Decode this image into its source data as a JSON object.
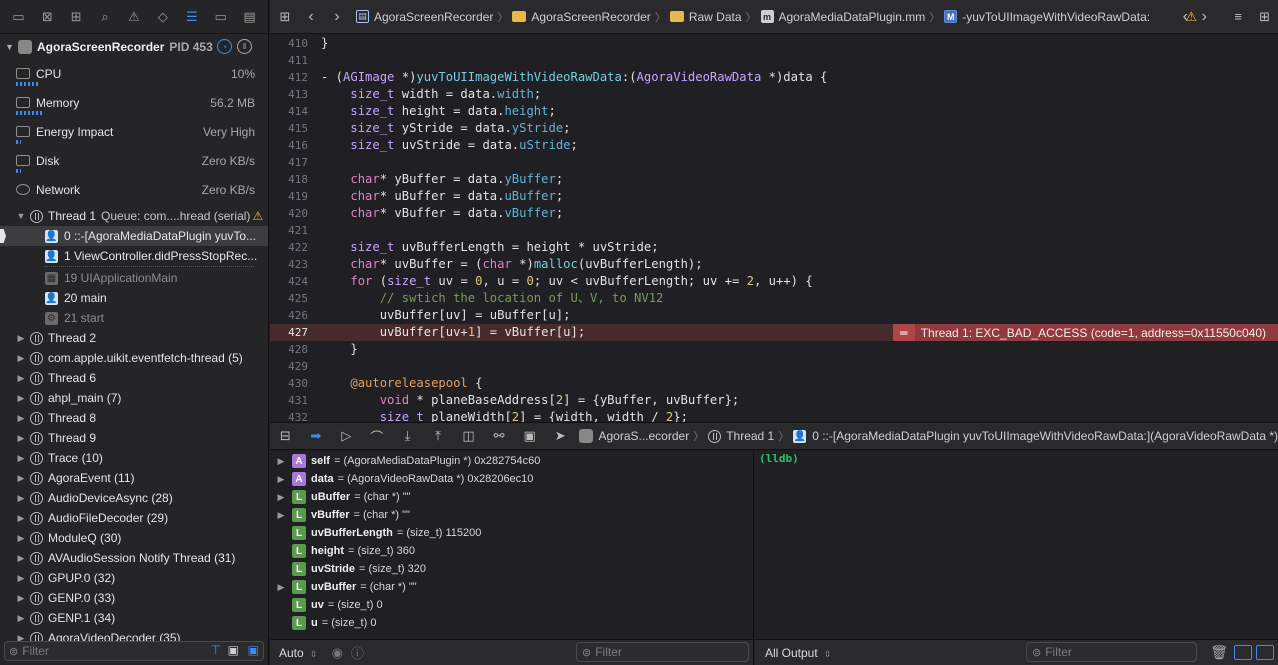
{
  "navigator": {
    "toolbar_icons": [
      "folder-icon",
      "source-control-icon",
      "symbol-icon",
      "find-icon",
      "issue-icon",
      "test-icon",
      "debug-navigator-icon",
      "breakpoint-icon",
      "report-icon"
    ],
    "process": {
      "name": "AgoraScreenRecorder",
      "pid": "PID 453"
    },
    "gauges": [
      {
        "label": "CPU",
        "value": "10%",
        "level": 0.1
      },
      {
        "label": "Memory",
        "value": "56.2 MB",
        "level": 0.12
      },
      {
        "label": "Energy Impact",
        "value": "Very High",
        "level": 0.02
      },
      {
        "label": "Disk",
        "value": "Zero KB/s",
        "level": 0.02
      },
      {
        "label": "Network",
        "value": "Zero KB/s",
        "level": 0
      }
    ],
    "thread1": {
      "label": "Thread 1",
      "queue": "Queue: com....hread (serial)"
    },
    "frames": [
      {
        "label": "0 ::-[AgoraMediaDataPlugin yuvTo..."
      },
      {
        "label": "1 ViewController.didPressStopRec..."
      },
      {
        "label": "19 UIApplicationMain"
      },
      {
        "label": "20 main"
      },
      {
        "label": "21 start"
      }
    ],
    "threads": [
      "Thread 2",
      "com.apple.uikit.eventfetch-thread (5)",
      "Thread 6",
      "ahpl_main (7)",
      "Thread 8",
      "Thread 9",
      "Trace (10)",
      "AgoraEvent (11)",
      "AudioDeviceAsync (28)",
      "AudioFileDecoder (29)",
      "ModuleQ (30)",
      "AVAudioSession Notify Thread (31)",
      "GPUP.0 (32)",
      "GENP.0 (33)",
      "GENP.1 (34)",
      "AgoraVideoDecoder (35)"
    ],
    "filter_placeholder": "Filter"
  },
  "jumpbar": {
    "crumbs": [
      "AgoraScreenRecorder",
      "AgoraScreenRecorder",
      "Raw Data",
      "AgoraMediaDataPlugin.mm",
      "-yuvToUIImageWithVideoRawData:"
    ]
  },
  "code": {
    "lines": [
      {
        "n": "410",
        "html": "}"
      },
      {
        "n": "411",
        "html": ""
      },
      {
        "n": "412",
        "html": "- (<span class=\"ty\">AGImage</span> *)<span class=\"fn\">yuvToUIImageWithVideoRawData</span>:(<span class=\"ty\">AgoraVideoRawData</span> *)data {"
      },
      {
        "n": "413",
        "html": "    <span class=\"ty\">size_t</span> width = data.<span class=\"pr\">width</span>;"
      },
      {
        "n": "414",
        "html": "    <span class=\"ty\">size_t</span> height = data.<span class=\"pr\">height</span>;"
      },
      {
        "n": "415",
        "html": "    <span class=\"ty\">size_t</span> yStride = data.<span class=\"pr\">yStride</span>;"
      },
      {
        "n": "416",
        "html": "    <span class=\"ty\">size_t</span> uvStride = data.<span class=\"pr\">uStride</span>;"
      },
      {
        "n": "417",
        "html": ""
      },
      {
        "n": "418",
        "html": "    <span class=\"kw\">char</span>* yBuffer = data.<span class=\"pr\">yBuffer</span>;"
      },
      {
        "n": "419",
        "html": "    <span class=\"kw\">char</span>* uBuffer = data.<span class=\"pr\">uBuffer</span>;"
      },
      {
        "n": "420",
        "html": "    <span class=\"kw\">char</span>* vBuffer = data.<span class=\"pr\">vBuffer</span>;"
      },
      {
        "n": "421",
        "html": ""
      },
      {
        "n": "422",
        "html": "    <span class=\"ty\">size_t</span> uvBufferLength = height * uvStride;"
      },
      {
        "n": "423",
        "html": "    <span class=\"kw\">char</span>* uvBuffer = (<span class=\"kw\">char</span> *)<span class=\"fn\">malloc</span>(uvBufferLength);"
      },
      {
        "n": "424",
        "html": "    <span class=\"kw\">for</span> (<span class=\"ty\">size_t</span> uv = <span class=\"nm\">0</span>, u = <span class=\"nm\">0</span>; uv &lt; uvBufferLength; uv += <span class=\"nm\">2</span>, u++) {"
      },
      {
        "n": "425",
        "html": "        <span class=\"cm\">// swtich the location of U、V, to NV12</span>"
      },
      {
        "n": "426",
        "html": "        uvBuffer[uv] = uBuffer[u];"
      },
      {
        "n": "427",
        "html": "        uvBuffer[uv+<span class=\"nm\">1</span>] = vBuffer[u];",
        "error": true
      },
      {
        "n": "428",
        "html": "    }"
      },
      {
        "n": "429",
        "html": ""
      },
      {
        "n": "430",
        "html": "    <span class=\"at\">@autoreleasepool</span> {"
      },
      {
        "n": "431",
        "html": "        <span class=\"kw\">void</span> * planeBaseAddress[<span class=\"nm\">2</span>] = {yBuffer, uvBuffer};"
      },
      {
        "n": "432",
        "html": "        <span class=\"ty\">size_t</span> planeWidth[<span class=\"nm\">2</span>] = {width, width / <span class=\"nm\">2</span>};"
      }
    ],
    "error_message": "Thread 1: EXC_BAD_ACCESS (code=1, address=0x11550c040)"
  },
  "debugbar": {
    "crumbs": [
      "AgoraS...ecorder",
      "Thread 1",
      "0 ::-[AgoraMediaDataPlugin yuvToUIImageWithVideoRawData:](AgoraVideoRawData *)"
    ]
  },
  "variables": [
    {
      "kind": "A",
      "name": "self",
      "value": "= (AgoraMediaDataPlugin *) 0x282754c60",
      "expandable": true
    },
    {
      "kind": "A",
      "name": "data",
      "value": "= (AgoraVideoRawData *) 0x28206ec10",
      "expandable": true
    },
    {
      "kind": "L",
      "name": "uBuffer",
      "value": "= (char *) \"\"",
      "expandable": true
    },
    {
      "kind": "L",
      "name": "vBuffer",
      "value": "= (char *) \"\"",
      "expandable": true
    },
    {
      "kind": "L",
      "name": "uvBufferLength",
      "value": "= (size_t) 115200",
      "expandable": false
    },
    {
      "kind": "L",
      "name": "height",
      "value": "= (size_t) 360",
      "expandable": false
    },
    {
      "kind": "L",
      "name": "uvStride",
      "value": "= (size_t) 320",
      "expandable": false
    },
    {
      "kind": "L",
      "name": "uvBuffer",
      "value": "= (char *) \"\"",
      "expandable": true
    },
    {
      "kind": "L",
      "name": "uv",
      "value": "= (size_t) 0",
      "expandable": false
    },
    {
      "kind": "L",
      "name": "u",
      "value": "= (size_t) 0",
      "expandable": false
    }
  ],
  "console": {
    "prompt": "(lldb)"
  },
  "bottom": {
    "var_scope": "Auto",
    "var_filter_placeholder": "Filter",
    "console_scope": "All Output",
    "console_filter_placeholder": "Filter"
  },
  "colors": {
    "accent": "#3b8cf0",
    "error_bg": "#8f3a3d",
    "warning": "#f2c12e"
  }
}
